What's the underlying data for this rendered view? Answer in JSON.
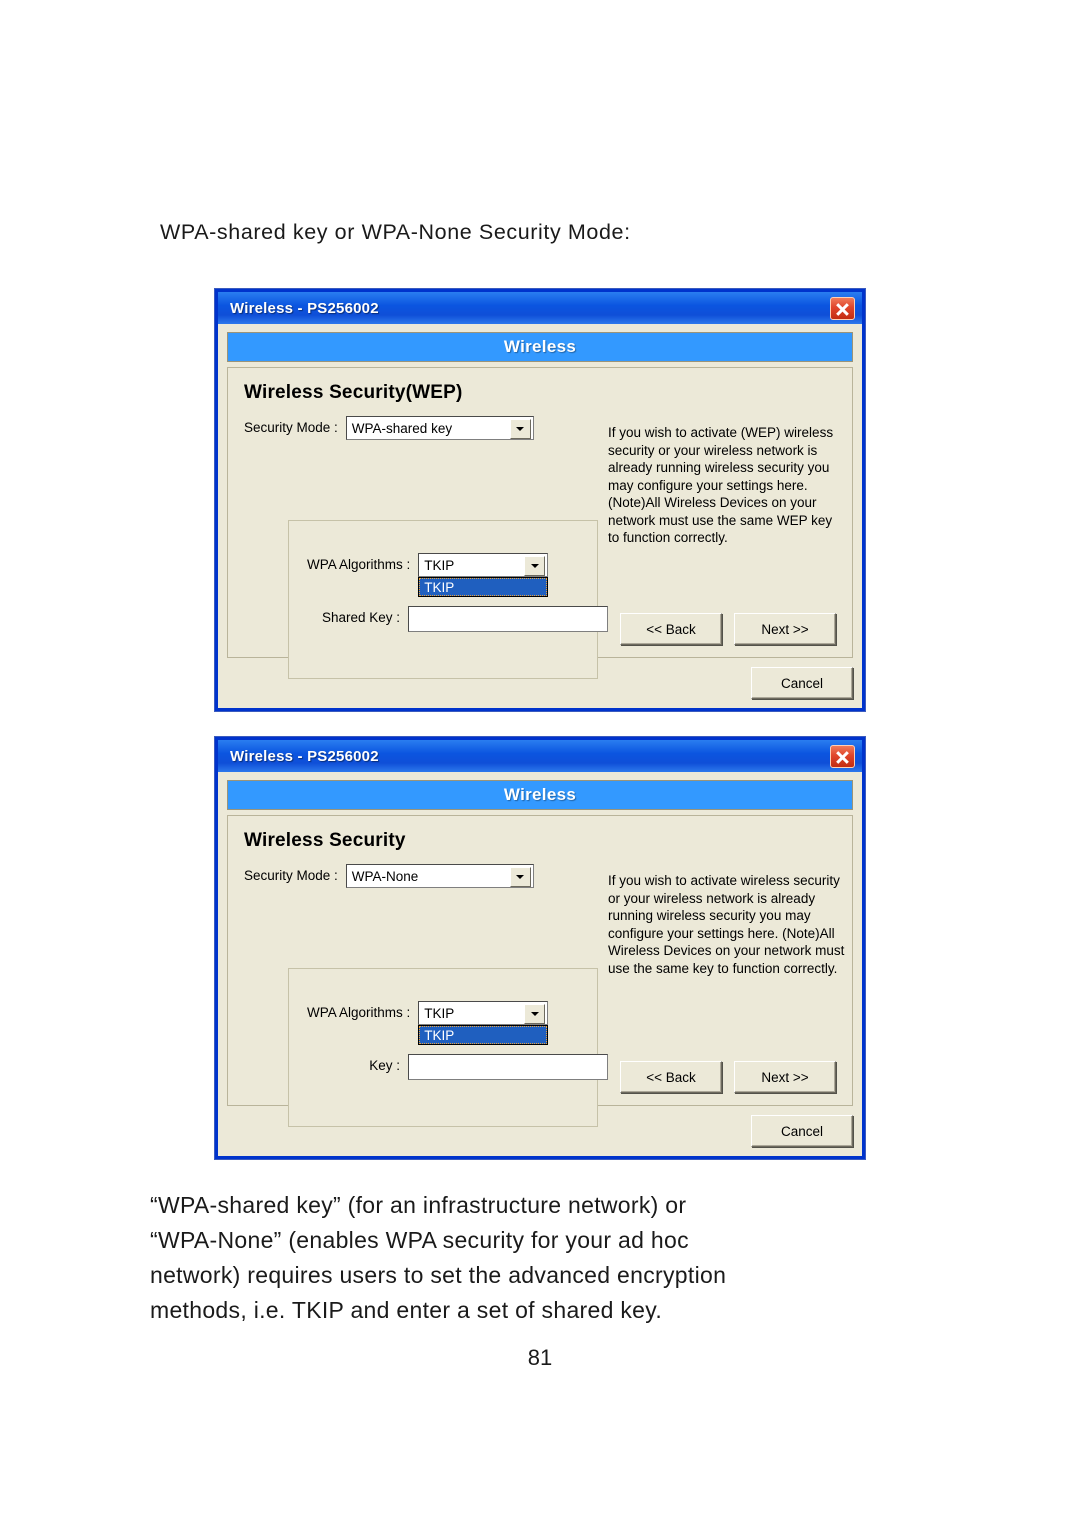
{
  "document": {
    "heading": "WPA-shared key or WPA-None Security Mode:",
    "paragraph_lines": [
      "“WPA-shared key” (for an infrastructure network) or",
      "“WPA-None” (enables WPA security for your ad hoc",
      "network) requires users to set the advanced encryption",
      "methods, i.e. TKIP and enter a set of shared key."
    ],
    "page_number": "81"
  },
  "colors": {
    "titlebar_blue": "#0b55e0",
    "banner_blue": "#3399ff",
    "dialog_face": "#ece9d8",
    "frame_blue": "#0033cc",
    "close_red": "#c32c12",
    "dropdown_highlight": "#1f5fbf"
  },
  "dialog1": {
    "title": "Wireless - PS256002",
    "close_icon": "close-icon",
    "banner": "Wireless",
    "section_title": "Wireless Security(WEP)",
    "security_mode_label": "Security Mode :",
    "security_mode_value": "WPA-shared key",
    "security_mode_options": [
      "WPA-shared key"
    ],
    "help_text": "If you wish to activate (WEP) wireless security or your wireless network is already running wireless security you may configure your settings here. (Note)All Wireless Devices on your network must use the same WEP key to function correctly.",
    "wpa_algorithms_label": "WPA Algorithms :",
    "wpa_algorithms_value": "TKIP",
    "wpa_algorithms_open_option": "TKIP",
    "key_label": "Shared Key :",
    "key_value": "",
    "back_label": "<< Back",
    "next_label": "Next >>",
    "cancel_label": "Cancel"
  },
  "dialog2": {
    "title": "Wireless - PS256002",
    "close_icon": "close-icon",
    "banner": "Wireless",
    "section_title": "Wireless Security",
    "security_mode_label": "Security Mode :",
    "security_mode_value": "WPA-None",
    "security_mode_options": [
      "WPA-None"
    ],
    "help_text": "If you wish to activate wireless security or your wireless network is already running wireless security you may configure your settings here. (Note)All Wireless Devices on your network must use the same key to function correctly.",
    "wpa_algorithms_label": "WPA Algorithms :",
    "wpa_algorithms_value": "TKIP",
    "wpa_algorithms_open_option": "TKIP",
    "key_label": "Key :",
    "key_value": "",
    "back_label": "<< Back",
    "next_label": "Next >>",
    "cancel_label": "Cancel"
  }
}
